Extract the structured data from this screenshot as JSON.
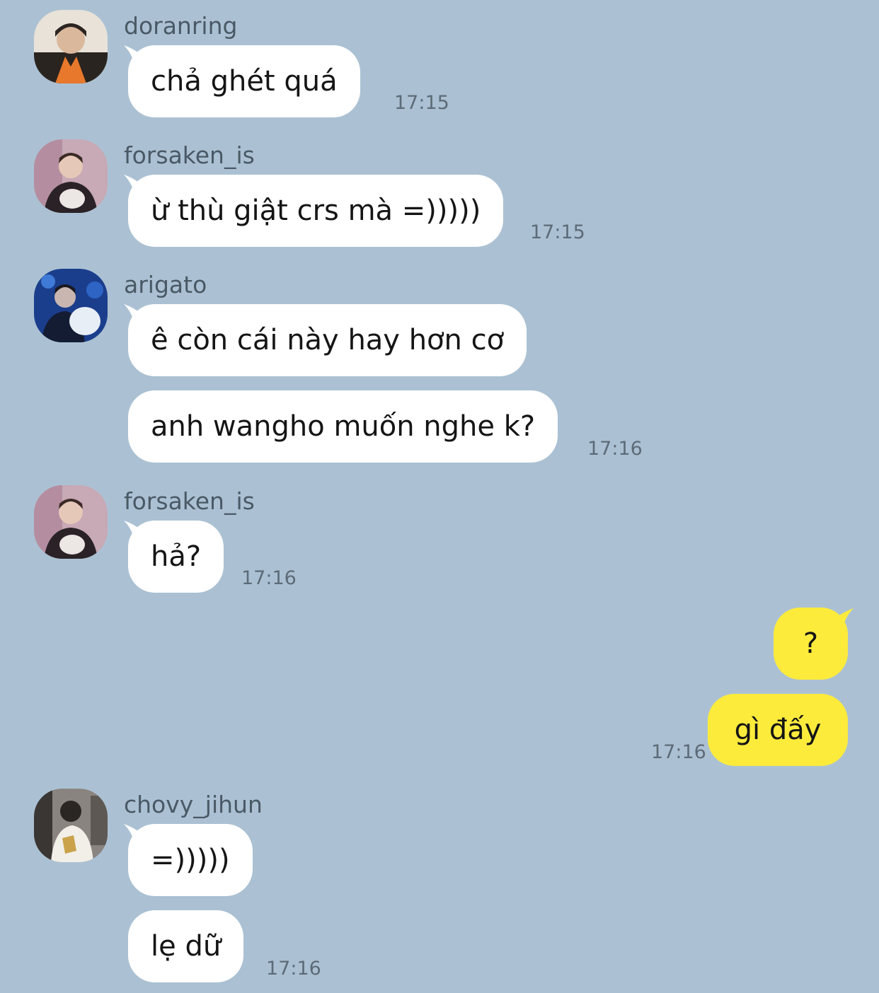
{
  "colors": {
    "background": "#abc1d3",
    "incoming_bubble": "#ffffff",
    "outgoing_bubble": "#fdeb3c"
  },
  "messages": [
    {
      "sender": "doranring",
      "text": "chả ghét quá",
      "time": "17:15"
    },
    {
      "sender": "forsaken_is",
      "text": "ừ thù giật crs mà =)))))",
      "time": "17:15"
    },
    {
      "sender": "arigato",
      "text_1": "ê còn cái này hay hơn cơ",
      "text_2": "anh wangho muốn nghe k?",
      "time": "17:16"
    },
    {
      "sender": "forsaken_is",
      "text": "hả?",
      "time": "17:16"
    },
    {
      "sender": "me",
      "text_1": "?",
      "text_2": "gì đấy",
      "time": "17:16"
    },
    {
      "sender": "chovy_jihun",
      "text_1": "=)))))",
      "text_2": "lẹ dữ",
      "time": "17:16"
    }
  ],
  "icons": [
    "avatar-doranring",
    "avatar-forsaken_is",
    "avatar-arigato",
    "avatar-chovy_jihun"
  ]
}
